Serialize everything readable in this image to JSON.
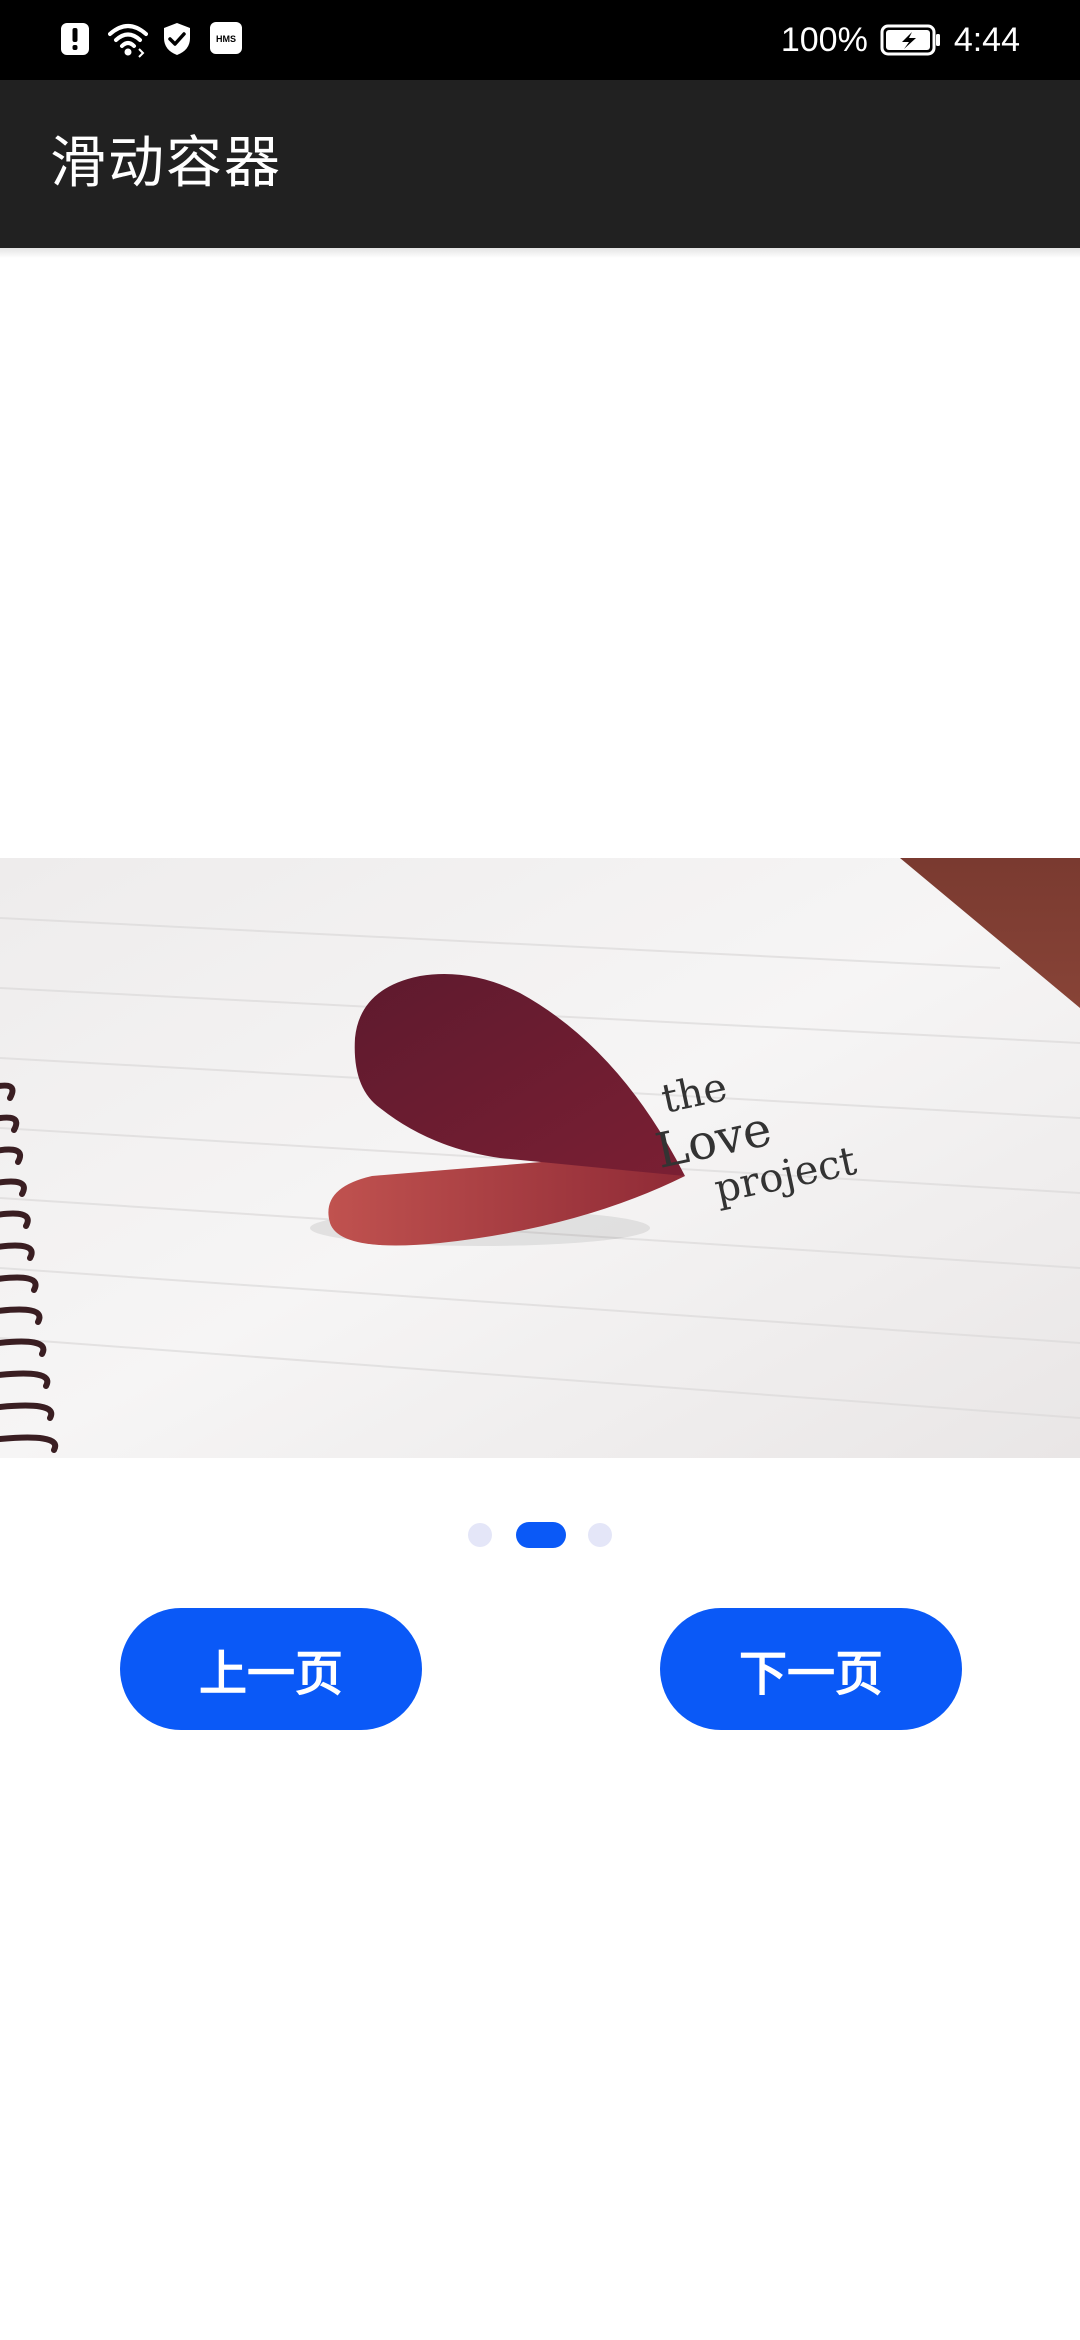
{
  "status_bar": {
    "battery_percent": "100%",
    "time": "4:44",
    "icons": [
      "alert-icon",
      "wifi-icon",
      "shield-check-icon",
      "hms-icon",
      "battery-charging-icon"
    ],
    "hms_label": "HMS"
  },
  "app_bar": {
    "title": "滑动容器"
  },
  "swiper": {
    "current_index": 1,
    "page_count": 3,
    "image_text": [
      "the",
      "Love",
      "project"
    ]
  },
  "buttons": {
    "prev_label": "上一页",
    "next_label": "下一页"
  },
  "colors": {
    "accent": "#0a59f7",
    "app_bar_bg": "#212121",
    "status_bar_bg": "#000000",
    "indicator_inactive": "#e4e6f8"
  }
}
